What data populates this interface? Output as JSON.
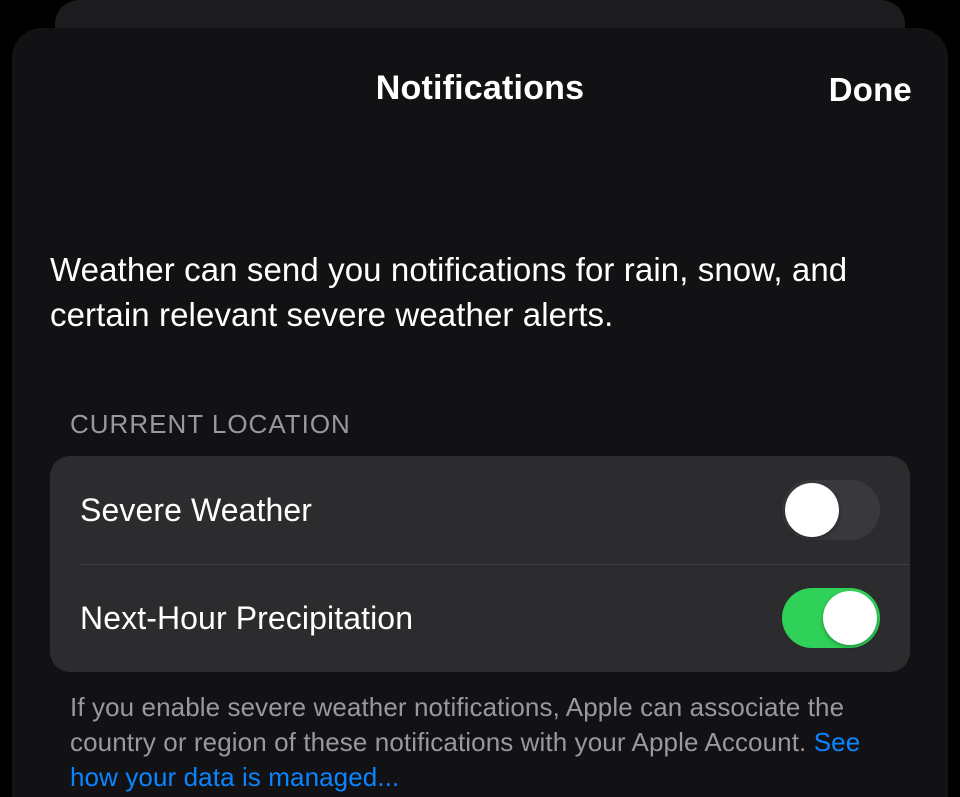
{
  "nav": {
    "title": "Notifications",
    "done": "Done"
  },
  "intro": "Weather can send you notifications for rain, snow, and certain relevant severe weather alerts.",
  "section": {
    "header": "CURRENT LOCATION",
    "rows": [
      {
        "label": "Severe Weather",
        "on": false
      },
      {
        "label": "Next-Hour Precipitation",
        "on": true
      }
    ],
    "footer_text": "If you enable severe weather notifications, Apple can associate the country or region of these notifications with your Apple Account. ",
    "footer_link": "See how your data is managed..."
  }
}
